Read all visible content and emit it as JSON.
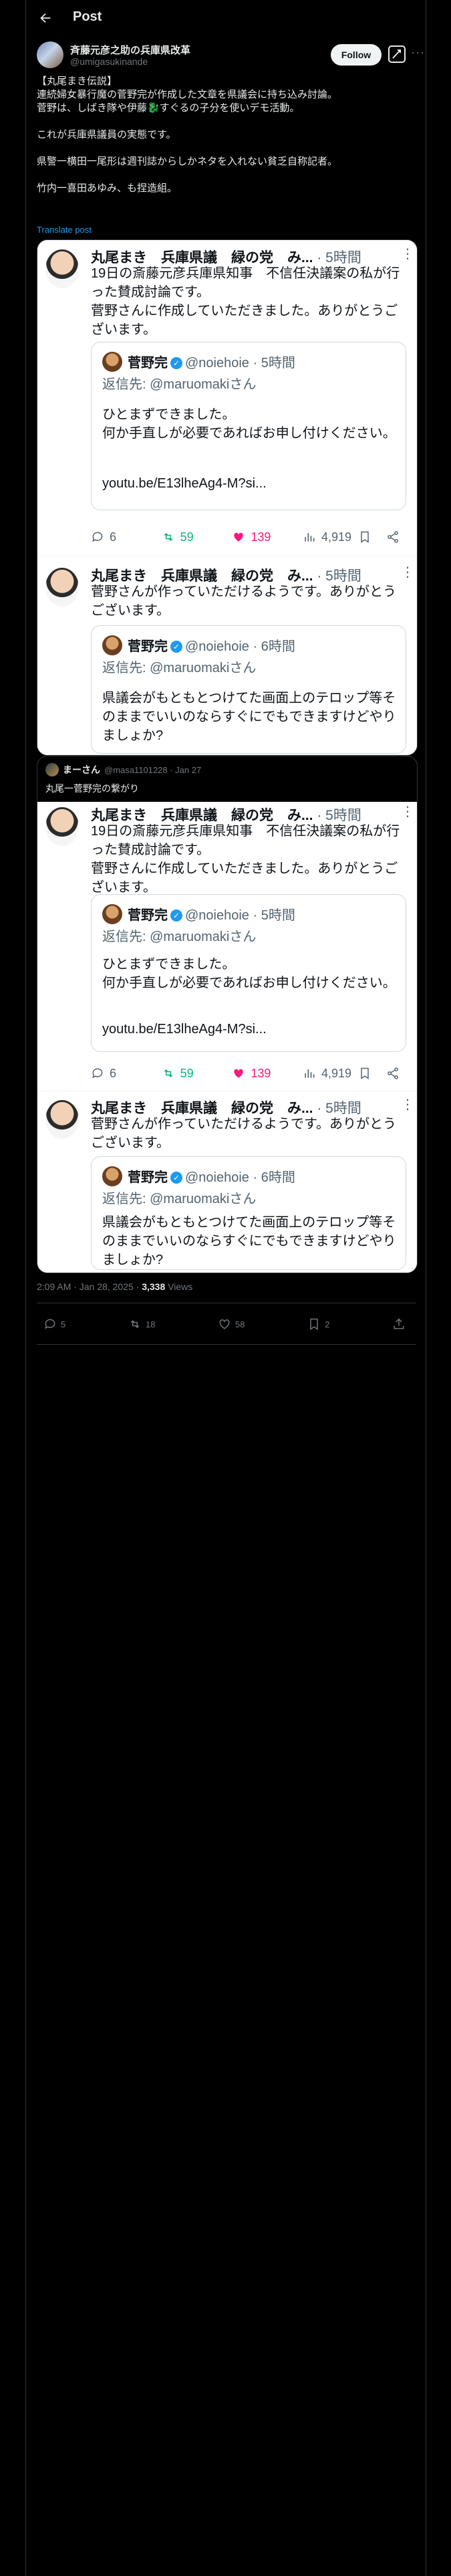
{
  "header": {
    "title": "Post"
  },
  "author": {
    "name": "斉藤元彦之助の兵庫県改革",
    "handle": "@umigasukinande",
    "follow_label": "Follow"
  },
  "post": {
    "text": "【丸尾まき伝説】\n連続婦女暴行魔の菅野完が作成した文章を県議会に持ち込み討論。\n菅野は、しばき隊や伊藤🐉すぐるの子分を使いデモ活動。\n\nこれが兵庫県議員の実態です。\n\n県警一横田一尾形は週刊誌からしかネタを入れない貧乏自称記者。\n\n竹内一喜田あゆみ、も捏造組。",
    "translate_label": "Translate post",
    "timestamp": "2:09 AM · Jan 28, 2025",
    "views_count": "3,338",
    "views_label": "Views"
  },
  "screenshot": {
    "tweet1": {
      "name": "丸尾まき　兵庫県議　緑の党　み...",
      "time": "· 5時間",
      "text": "19日の斎藤元彦兵庫県知事　不信任決議案の私が行った賛成討論です。\n菅野さんに作成していただきました。ありがとうございます。",
      "reply_count": "6",
      "retweet_count": "59",
      "like_count": "139",
      "view_count": "4,919"
    },
    "card1": {
      "name": "菅野完",
      "handle": "@noiehoie · 5時間",
      "reply_to": "返信先: @maruomakiさん",
      "text": "ひとまずできました。\n何か手直しが必要であればお申し付けください。",
      "link": "youtu.be/E13lheAg4-M?si..."
    },
    "tweet2": {
      "name": "丸尾まき　兵庫県議　緑の党　み...",
      "time": "· 5時間",
      "text": "菅野さんが作っていただけるようです。ありがとうございます。"
    },
    "card2": {
      "name": "菅野完",
      "handle": "@noiehoie · 6時間",
      "reply_to": "返信先: @maruomakiさん",
      "text": "県議会がもともとつけてた画面上のテロップ等そのままでいいのならすぐにでもできますけどやりましょか?"
    }
  },
  "quote": {
    "name": "まーさん",
    "handle": "@masa1101228 · Jan 27",
    "text": "丸尾一菅野完の繋がり"
  },
  "actions": {
    "replies": "5",
    "reposts": "18",
    "likes": "58",
    "bookmarks": "2"
  },
  "colors": {
    "accent": "#1d9bf0",
    "retweet": "#00ba7c",
    "like": "#f91880"
  }
}
